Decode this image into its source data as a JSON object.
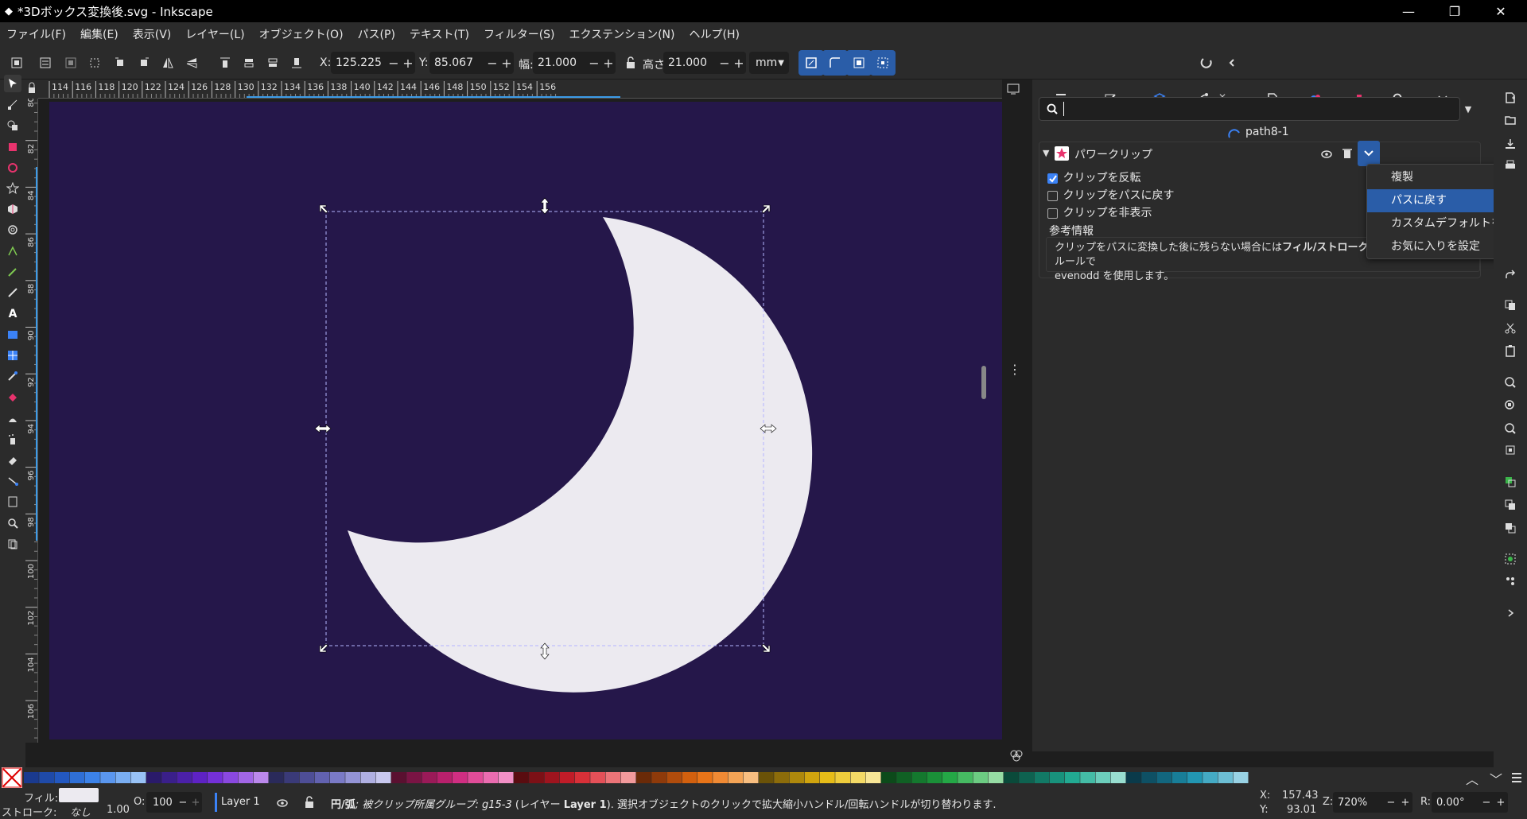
{
  "window": {
    "title": "*3Dボックス変換後.svg - Inkscape",
    "minimize": "—",
    "maximize": "❐",
    "close": "✕"
  },
  "menu": [
    "ファイル(F)",
    "編集(E)",
    "表示(V)",
    "レイヤー(L)",
    "オブジェクト(O)",
    "パス(P)",
    "テキスト(T)",
    "フィルター(S)",
    "エクステンション(N)",
    "ヘルプ(H)"
  ],
  "toolbar": {
    "x_label": "X:",
    "x_value": "125.225",
    "y_label": "Y:",
    "y_value": "85.067",
    "w_label": "幅:",
    "w_value": "21.000",
    "h_label": "高さ:",
    "h_value": "21.000",
    "unit": "mm",
    "minus": "−",
    "plus": "+"
  },
  "ruler": {
    "h_ticks": [
      "114",
      "116",
      "118",
      "120",
      "122",
      "124",
      "126",
      "128",
      "130",
      "132",
      "134",
      "136",
      "138",
      "140",
      "142",
      "144",
      "146",
      "148",
      "150",
      "152",
      "154",
      "156"
    ],
    "v_ticks": [
      "80",
      "82",
      "84",
      "86",
      "88",
      "90",
      "92",
      "94",
      "96",
      "98",
      "100",
      "102",
      "104",
      "106",
      "108"
    ]
  },
  "panel": {
    "search_placeholder": "",
    "object_id": "path8-1",
    "effect_name": "パワークリップ",
    "options": [
      {
        "label": "クリップを反転",
        "checked": true
      },
      {
        "label": "クリップをパスに戻す",
        "checked": false
      },
      {
        "label": "クリップを非表示",
        "checked": false
      }
    ],
    "info_title": "参考情報",
    "info_text_1": "クリップをパスに変換した後に残らない場合には",
    "info_text_bold": "フィル/ストローク",
    "info_text_2": "ダイアログのフィルルールで",
    "info_text_3": "evenodd を使用します。",
    "dropdown": [
      "複製",
      "パスに戻す",
      "カスタムデフォルトを設定",
      "お気に入りを設定"
    ],
    "dropdown_selected": 1
  },
  "status": {
    "fill_label": "フィル:",
    "stroke_label": "ストローク:",
    "stroke_value": "なし",
    "stroke_width": "1.00",
    "opacity_label": "O:",
    "opacity_value": "100",
    "layer": "Layer 1",
    "message_a": "円/弧",
    "message_b": "; 被クリップ所属グループ: ",
    "message_c": "g15-3",
    "message_d": " (レイヤー ",
    "message_e": "Layer 1",
    "message_f": "). 選択オブジェクトのクリックで拡大縮小ハンドル/回転ハンドルが切り替わります.",
    "cursor_x_label": "X:",
    "cursor_x": "157.43",
    "cursor_y_label": "Y:",
    "cursor_y": "93.01",
    "zoom_label": "Z:",
    "zoom": "720%",
    "rotate_label": "R:",
    "rotate": "0.00°"
  },
  "colors": {
    "canvas_bg": "#25174a",
    "moon_fill": "#eceaf0",
    "accent": "#2a5da8"
  }
}
